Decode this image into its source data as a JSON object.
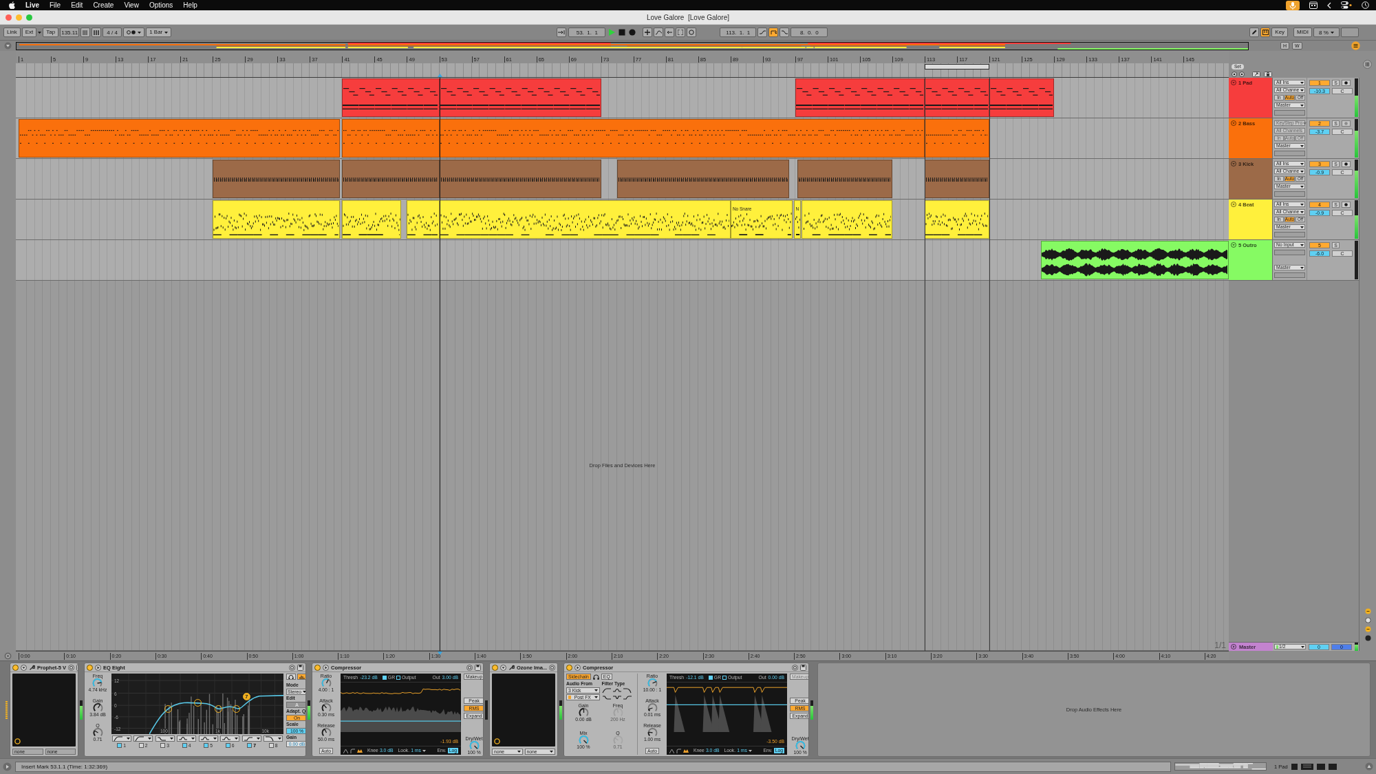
{
  "menu_bar": {
    "app": "Live",
    "items": [
      "File",
      "Edit",
      "Create",
      "View",
      "Options",
      "Help"
    ]
  },
  "window": {
    "title": "Love Galore  [Love Galore]"
  },
  "control_bar": {
    "link": "Link",
    "ext": "Ext",
    "tap": "Tap",
    "tempo": "135.11",
    "signature": "4 / 4",
    "quantization": "1 Bar",
    "position": "53.  1.  1",
    "playing": true,
    "recording": false,
    "loop_start": "113.  1.  1",
    "loop_on": true,
    "loop_length": "8.  0.  0",
    "draw_mode": false,
    "computer_midi_keyboard": true,
    "key": "Key",
    "midi": "MIDI",
    "cpu": "8 %"
  },
  "overview": {
    "buttons": [
      "H",
      "W"
    ]
  },
  "beat_ruler": {
    "labels": [
      "1",
      "5",
      "9",
      "13",
      "17",
      "21",
      "25",
      "29",
      "33",
      "37",
      "41",
      "45",
      "49",
      "53",
      "57",
      "61",
      "65",
      "69",
      "73",
      "77",
      "81",
      "85",
      "89",
      "93",
      "97",
      "101",
      "105",
      "109",
      "113",
      "117",
      "121",
      "125",
      "129",
      "133",
      "137",
      "141",
      "145"
    ],
    "set": "Set"
  },
  "tracks": [
    {
      "name": "1 Pad",
      "color": "#f63d3d",
      "input": "All Ins",
      "channel": "All Channe",
      "io_disabled": false,
      "monitor": [
        {
          "label": "In",
          "selected": false
        },
        {
          "label": "Auto",
          "selected": true
        },
        {
          "label": "Off",
          "selected": false
        }
      ],
      "output": "Master",
      "number": "1",
      "active": true,
      "solo": "S",
      "soloed": false,
      "armed": false,
      "volume": "-10.3",
      "pan": "C",
      "level": 0.55,
      "clips": [
        {
          "kind": "midi"
        },
        {
          "kind": "midi"
        },
        {
          "kind": "midi"
        },
        {
          "kind": "midi"
        },
        {
          "kind": "midi"
        }
      ]
    },
    {
      "name": "2 Bass",
      "color": "#fa700c",
      "input": "KeyStep Pro",
      "channel": "All Channels",
      "io_disabled": true,
      "monitor": [
        {
          "label": "In",
          "selected": false
        },
        {
          "label": "Auto",
          "selected": false
        },
        {
          "label": "Off",
          "selected": false
        }
      ],
      "output": "Master",
      "number": "2",
      "active": true,
      "solo": "S",
      "soloed": false,
      "armed": false,
      "volume": "-3.7",
      "pan": "C",
      "level": 0.7,
      "clips": [
        {
          "kind": "midi"
        },
        {
          "kind": "midi"
        },
        {
          "kind": "midi"
        },
        {
          "kind": "midi"
        }
      ]
    },
    {
      "name": "3 Kick",
      "color": "#9c6a48",
      "input": "All Ins",
      "channel": "All Channe",
      "io_disabled": false,
      "monitor": [
        {
          "label": "In",
          "selected": false
        },
        {
          "label": "Auto",
          "selected": true
        },
        {
          "label": "Off",
          "selected": false
        }
      ],
      "output": "Master",
      "number": "3",
      "active": true,
      "solo": "S",
      "soloed": false,
      "armed": false,
      "volume": "-0.9",
      "pan": "C",
      "level": 0.72,
      "clips": [
        {
          "kind": "midi"
        },
        {
          "kind": "midi"
        },
        {
          "kind": "midi"
        },
        {
          "kind": "midi"
        },
        {
          "kind": "midi"
        },
        {
          "kind": "midi"
        }
      ]
    },
    {
      "name": "4 Beat",
      "color": "#fff03c",
      "input": "All Ins",
      "channel": "All Channe",
      "io_disabled": false,
      "monitor": [
        {
          "label": "In",
          "selected": false
        },
        {
          "label": "Auto",
          "selected": true
        },
        {
          "label": "Off",
          "selected": false
        }
      ],
      "output": "Master",
      "number": "4",
      "active": true,
      "solo": "S",
      "soloed": false,
      "armed": false,
      "volume": "-0.9",
      "pan": "C",
      "level": 0.6,
      "clips": [
        {
          "kind": "midi"
        },
        {
          "kind": "midi"
        },
        {
          "kind": "midi"
        },
        {
          "kind": "midi"
        },
        {
          "kind": "midi",
          "name": "No Snare"
        },
        {
          "kind": "midi",
          "name": "N"
        },
        {
          "kind": "midi"
        },
        {
          "kind": "midi"
        }
      ]
    },
    {
      "name": "5 Outro",
      "color": "#86fa63",
      "input": "No Input",
      "output": "Master",
      "number": "5",
      "active": true,
      "solo": "S",
      "soloed": false,
      "volume": "-6.0",
      "pan": "C",
      "clips": [
        {
          "kind": "audio"
        }
      ]
    }
  ],
  "arrangement": {
    "drop_hint": "Drop Files and Devices Here",
    "page": "1/1"
  },
  "master": {
    "name": "Master",
    "color": "#c383cf",
    "output": "1/2",
    "volume": "0",
    "cue": "0",
    "level": 0.75
  },
  "time_ruler": {
    "labels": [
      "0:00",
      "0:10",
      "0:20",
      "0:30",
      "0:40",
      "0:50",
      "1:00",
      "1:10",
      "1:20",
      "1:30",
      "1:40",
      "1:50",
      "2:00",
      "2:10",
      "2:20",
      "2:30",
      "2:40",
      "2:50",
      "3:00",
      "3:10",
      "3:20",
      "3:30",
      "3:40",
      "3:50",
      "4:00",
      "4:10",
      "4:20"
    ]
  },
  "devices": [
    {
      "kind": "plugin",
      "title": "Prophet-5 V",
      "on": true,
      "level": 0.7,
      "selectors": [
        {
          "value": "none",
          "kind": "field"
        },
        {
          "value": "none",
          "kind": "field"
        }
      ]
    },
    {
      "kind": "eq",
      "title": "EQ Eight",
      "on": true,
      "level": 0.7,
      "knobs": [
        {
          "label": "Freq",
          "value": "4.74 kHz",
          "accent": true
        },
        {
          "label": "Gain",
          "value": "3.84 dB",
          "accent": false
        },
        {
          "label": "Q",
          "value": "0.71",
          "accent": false
        }
      ],
      "gain_labels": [
        "12",
        "6",
        "0",
        "-6",
        "-12"
      ],
      "freq_labels": [
        "100",
        "1k",
        "10k"
      ],
      "bands": [
        {
          "number": "1",
          "kind": "low_cut",
          "on": true,
          "selected": false
        },
        {
          "number": "2",
          "kind": "low_cut",
          "on": false,
          "selected": false
        },
        {
          "number": "3",
          "kind": "low_shelf",
          "on": false,
          "selected": false
        },
        {
          "number": "4",
          "kind": "bell",
          "on": true,
          "selected": false
        },
        {
          "number": "5",
          "kind": "bell",
          "on": true,
          "selected": false
        },
        {
          "number": "6",
          "kind": "bell",
          "on": true,
          "selected": false
        },
        {
          "number": "7",
          "kind": "high_shelf",
          "on": true,
          "selected": true
        },
        {
          "number": "8",
          "kind": "high_cut",
          "on": false,
          "selected": false
        }
      ],
      "handle_label": "7",
      "analyze_on": true,
      "settings": [
        {
          "label": "Mode",
          "value": "Stereo",
          "kind": "dropdown"
        },
        {
          "label": "Edit",
          "value": "A",
          "kind": "field",
          "disabled": true
        },
        {
          "label": "Adapt. Q",
          "value": "On",
          "kind": "toggle",
          "on": true
        },
        {
          "label": "Scale",
          "value": "100 %",
          "kind": "number"
        },
        {
          "label": "Gain",
          "value": "0.00 dB",
          "kind": "field",
          "disabled": false
        }
      ]
    },
    {
      "kind": "compressor",
      "title": "Compressor",
      "on": true,
      "knobs": [
        {
          "label": "Ratio",
          "value": "4.00 : 1",
          "accent": true
        },
        {
          "label": "Attack",
          "value": "0.30 ms",
          "accent": false
        },
        {
          "label": "Release",
          "value": "50.0 ms",
          "accent": false
        }
      ],
      "auto": "Auto",
      "auto_on": false,
      "display": {
        "thresh_label": "Thresh",
        "thresh": "-23.2 dB",
        "gr": "GR",
        "gr_on": true,
        "output": "Output",
        "output_on": false,
        "out_label": "Out",
        "out": "3.00 dB",
        "reduction": "-1.93 dB",
        "knee_label": "Knee",
        "knee": "3.0 dB",
        "look_label": "Look.",
        "look": "1 ms",
        "env_label": "Env.",
        "env": "Log"
      },
      "makeup": "Makeup",
      "makeup_disabled": false,
      "modes": [
        {
          "label": "Peak",
          "selected": false
        },
        {
          "label": "RMS",
          "selected": true
        },
        {
          "label": "Expand",
          "selected": false
        }
      ],
      "drywet": {
        "label": "Dry/Wet",
        "value": "100 %",
        "accent": true
      }
    },
    {
      "kind": "plugin",
      "title": "Ozone Ima...",
      "on": true,
      "level": 0.7,
      "selectors": [
        {
          "value": "none",
          "kind": "dropdown"
        },
        {
          "value": "none",
          "kind": "dropdown"
        }
      ]
    },
    {
      "kind": "compressor",
      "title": "Compressor",
      "on": true,
      "level": 0.7,
      "sidechain": {
        "button": "Sidechain",
        "on": true,
        "eq": "EQ",
        "eq_on": false,
        "audio_from_label": "Audio From",
        "source": "3 Kick",
        "tap": "Post FX",
        "filter_label": "Filter Type",
        "knobs": [
          {
            "label": "Gain",
            "value": "0.00 dB",
            "accent": false
          },
          {
            "label": "Freq",
            "value": "200 Hz",
            "disabled": true
          },
          {
            "label": "Mix",
            "value": "100 %",
            "accent": true
          },
          {
            "label": "Q",
            "value": "0.71",
            "disabled": true
          }
        ]
      },
      "knobs": [
        {
          "label": "Ratio",
          "value": "10.00 : 1",
          "accent": true
        },
        {
          "label": "Attack",
          "value": "0.01 ms",
          "accent": false
        },
        {
          "label": "Release",
          "value": "1.00 ms",
          "accent": false
        }
      ],
      "auto": "Auto",
      "auto_on": false,
      "display": {
        "thresh_label": "Thresh",
        "thresh": "-12.1 dB",
        "gr": "GR",
        "gr_on": true,
        "output": "Output",
        "output_on": false,
        "out_label": "Out",
        "out": "0.00 dB",
        "reduction": "-3.50 dB",
        "knee_label": "Knee",
        "knee": "3.0 dB",
        "look_label": "Look.",
        "look": "1 ms",
        "env_label": "Env.",
        "env": "Log"
      },
      "makeup": "Makeup",
      "makeup_disabled": true,
      "modes": [
        {
          "label": "Peak",
          "selected": false
        },
        {
          "label": "RMS",
          "selected": true
        },
        {
          "label": "Expand",
          "selected": false
        }
      ],
      "drywet": {
        "label": "Dry/Wet",
        "value": "100 %",
        "accent": true
      }
    }
  ],
  "device_drop_hint": "Drop Audio Effects Here",
  "status_bar": {
    "message": "Insert Mark 53.1.1 (Time: 1:32:369)",
    "selected_track": "1 Pad"
  }
}
